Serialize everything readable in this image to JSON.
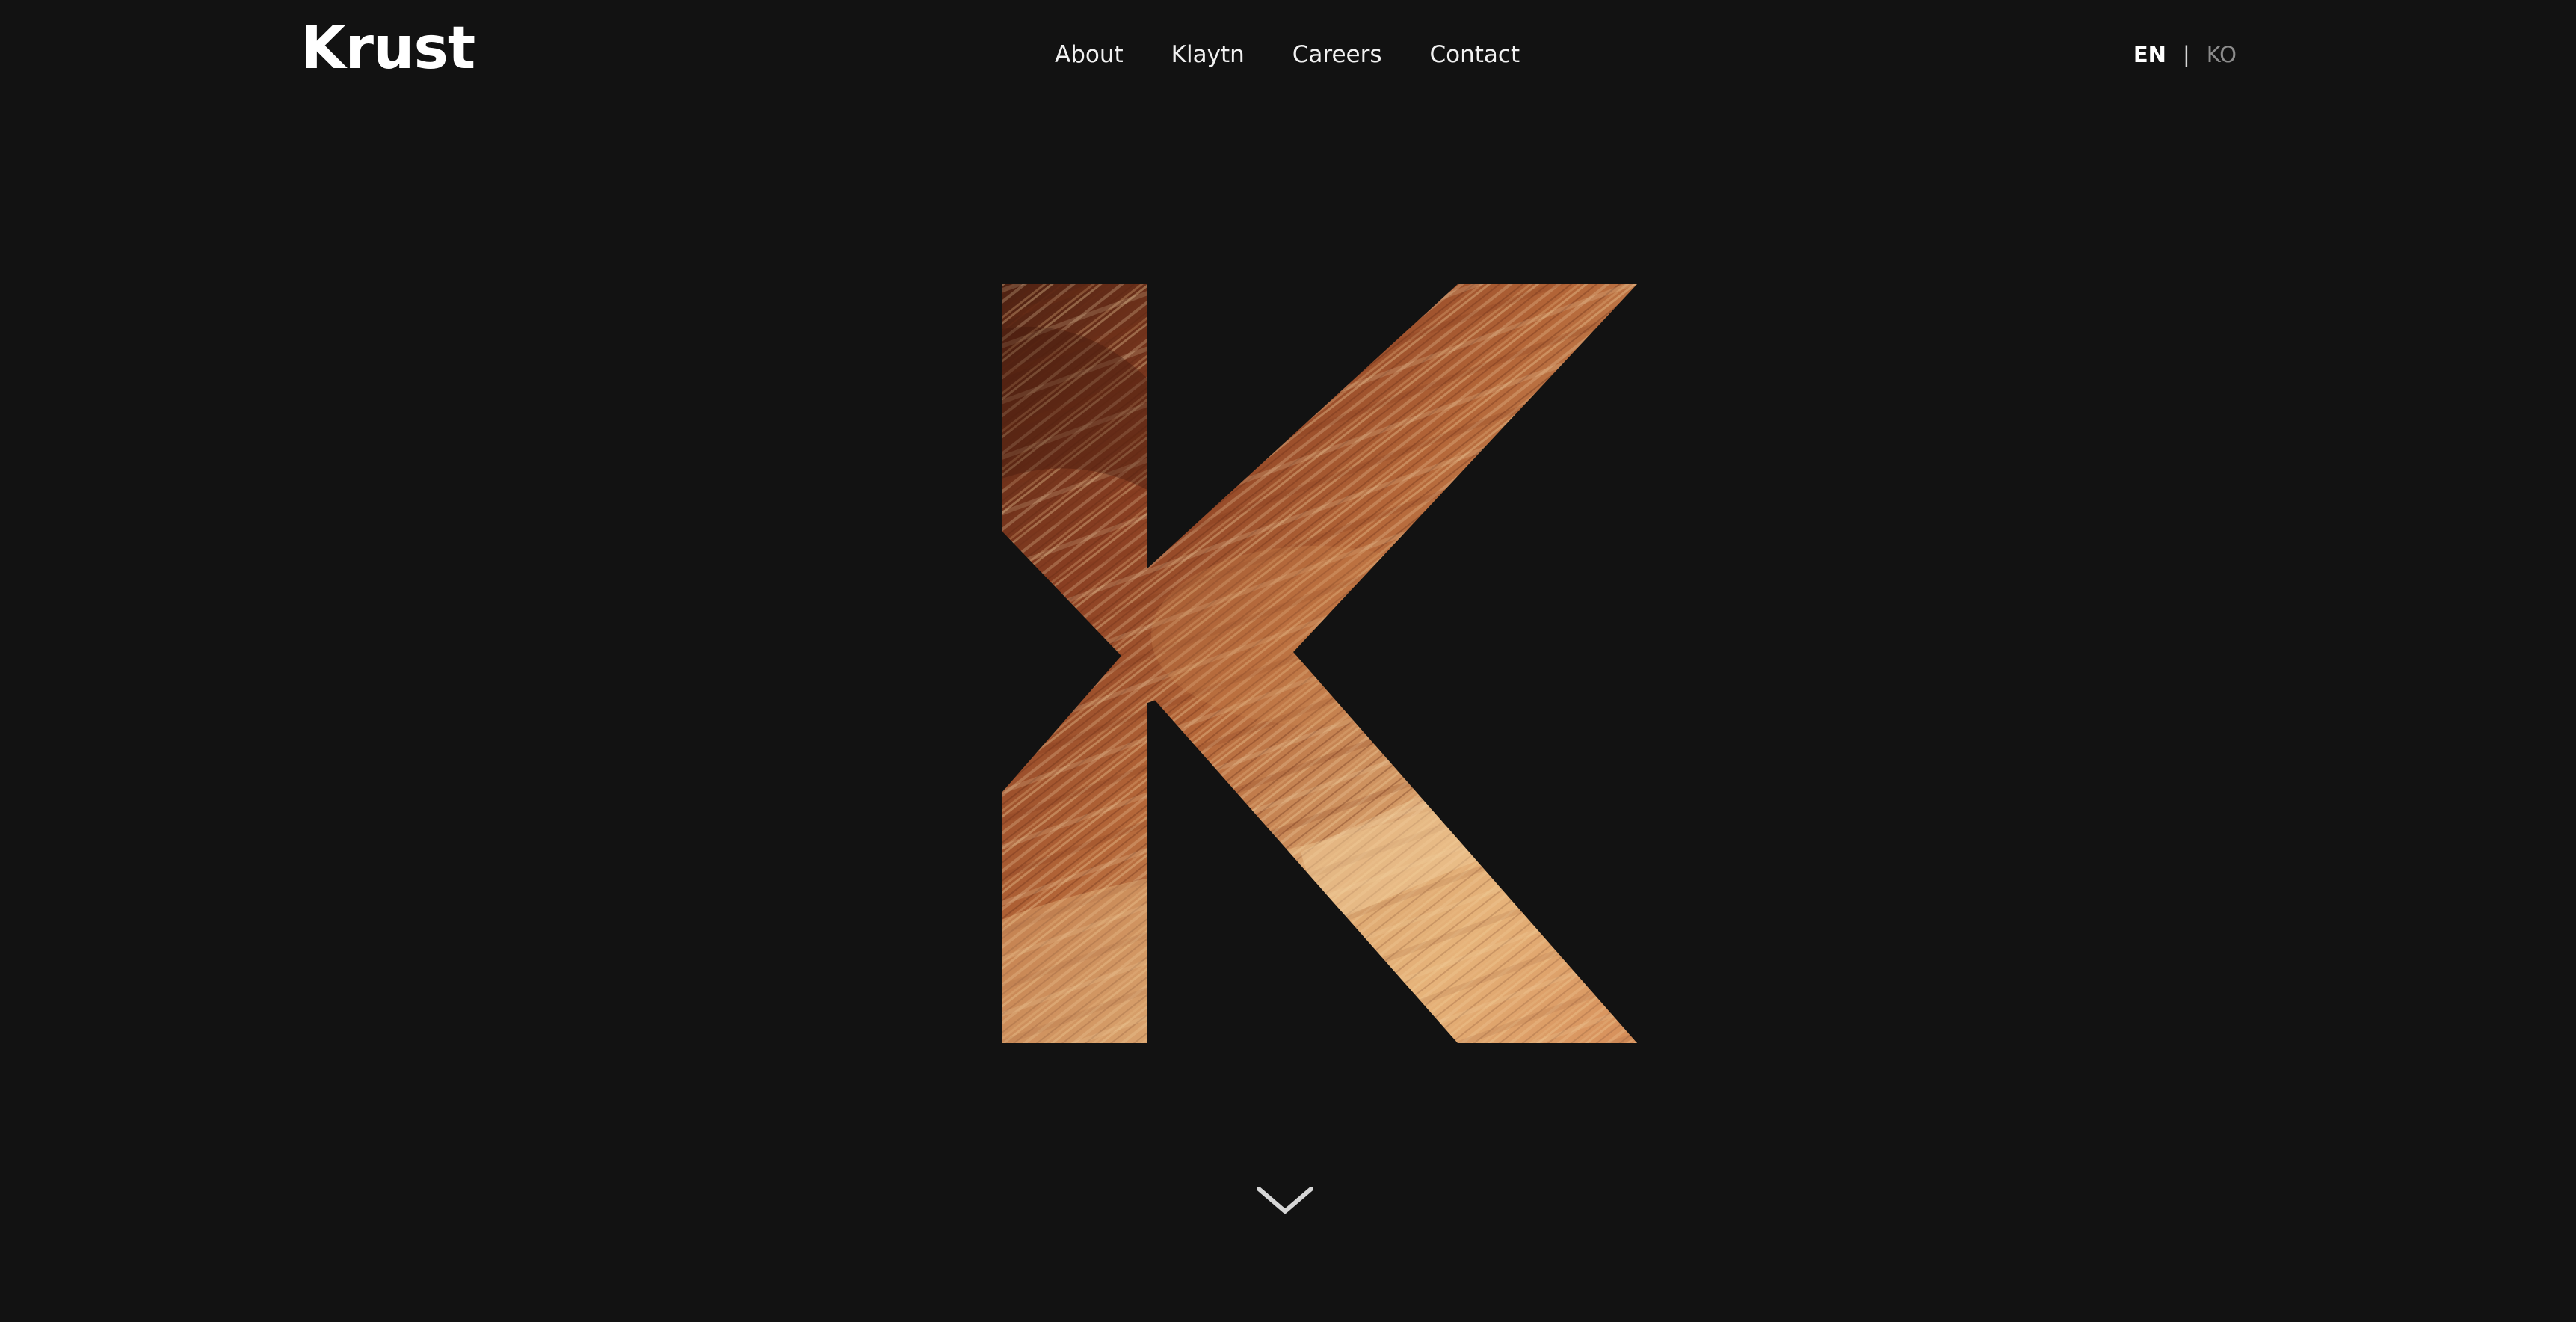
{
  "header": {
    "logo_text": "Krust",
    "nav": [
      {
        "label": "About"
      },
      {
        "label": "Klaytn"
      },
      {
        "label": "Careers"
      },
      {
        "label": "Contact"
      }
    ],
    "language": {
      "active": "EN",
      "separator": "|",
      "inactive": "KO"
    }
  },
  "hero": {
    "letter": "K",
    "texture": "sandstone-waves",
    "palette": [
      "#5a2614",
      "#8e4424",
      "#b86a3e",
      "#d99a63",
      "#edc48e",
      "#f6dcae"
    ]
  },
  "scroll": {
    "icon": "chevron-down-icon"
  },
  "colors": {
    "background": "#121212",
    "text": "#ffffff",
    "muted": "#8c8c8c"
  }
}
